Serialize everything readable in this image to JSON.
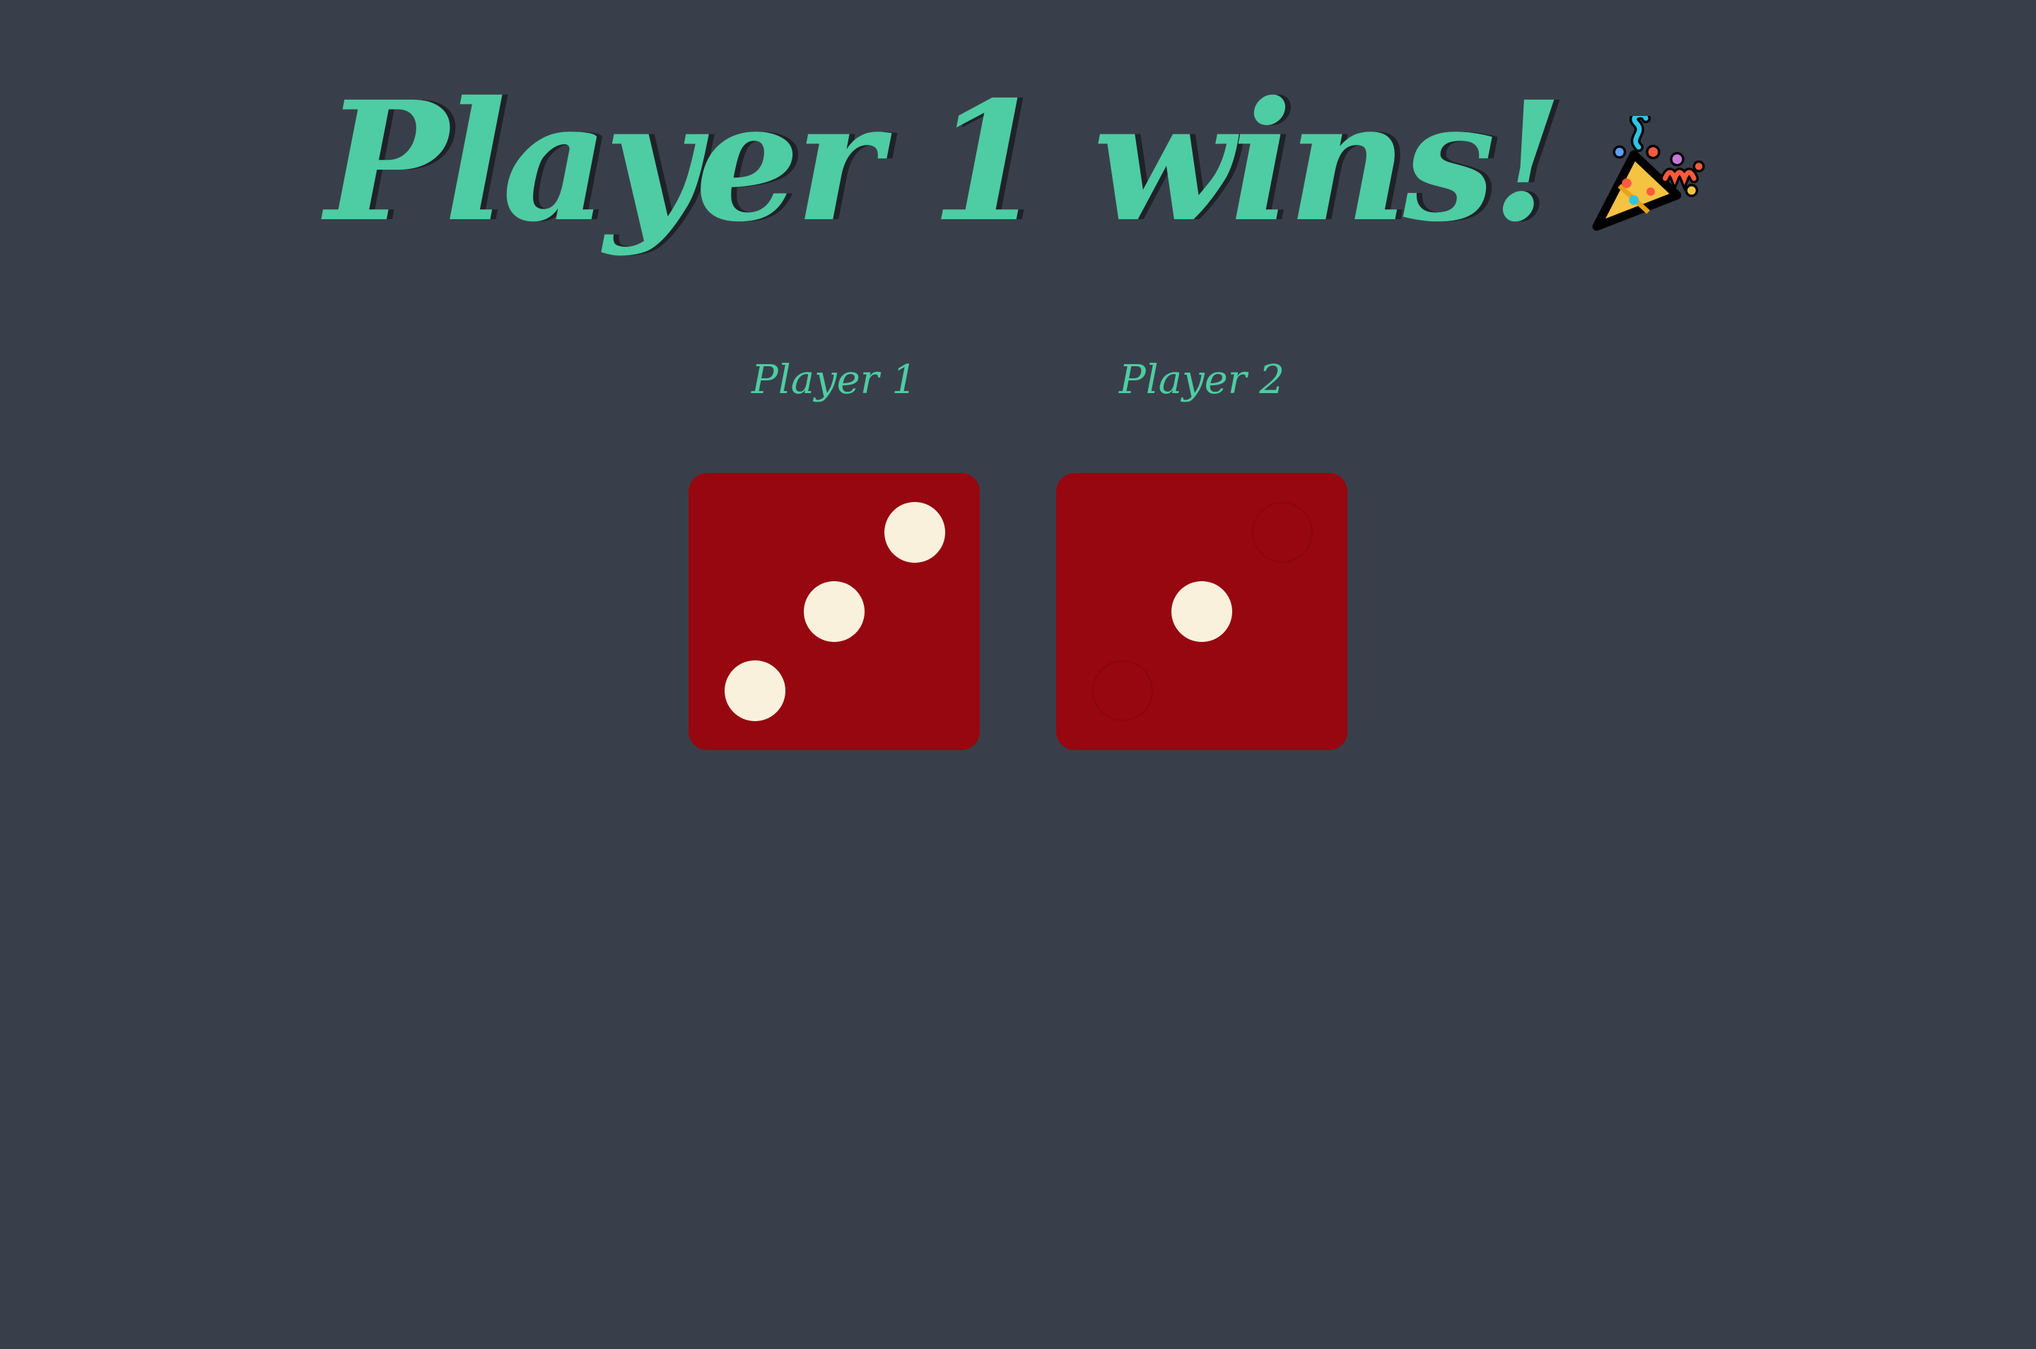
{
  "headline": {
    "text": "Player 1 wins!",
    "emoji_icon": "party-popper-icon",
    "color": "#4ecca3"
  },
  "players": [
    {
      "label": "Player 1",
      "die_value": 3
    },
    {
      "label": "Player 2",
      "die_value": 1
    }
  ],
  "colors": {
    "background": "#393f4a",
    "accent": "#4ecca3",
    "die_face": "#960710",
    "pip": "#faf1dc"
  }
}
